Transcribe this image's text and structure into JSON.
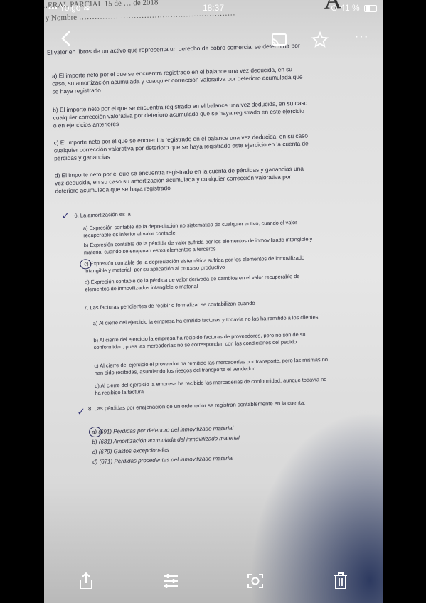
{
  "status": {
    "carrier": "Yoigo",
    "time": "18:37",
    "battery": "41 %"
  },
  "document": {
    "header_line1": "…ERAL PARCIAL 15 de … de 2018",
    "header_line2": "s y Nombre ……………………………………………………",
    "question5": {
      "text": "El valor en libros de un activo que representa un derecho de cobro comercial se determina por",
      "options": [
        {
          "letter": "a)",
          "text": "El importe neto por el que se encuentra registrado en el balance una vez deducida, en su caso, su amortización acumulada y cualquier corrección valorativa por deterioro acumulada que se haya registrado"
        },
        {
          "letter": "b)",
          "text": "El importe neto por el que se encuentra registrado en el balance una vez deducida, en su caso cualquier corrección valorativa por deterioro acumulada que se haya registrado en este ejercicio o en ejercicios anteriores"
        },
        {
          "letter": "c)",
          "text": "El importe neto por el que se encuentra registrado en el balance una vez deducida, en su caso cualquier corrección valorativa por deterioro que se haya registrado este ejercicio en la cuenta de pérdidas y ganancias"
        },
        {
          "letter": "d)",
          "text": "El importe neto por el que se encuentra registrado en la cuenta de pérdidas y ganancias una vez deducida, en su caso su amortización acumulada y cualquier corrección valorativa por deterioro acumulada que se haya registrado"
        }
      ]
    },
    "question6": {
      "number": "6.",
      "text": "La amortización es la",
      "options": [
        {
          "letter": "a)",
          "text": "Expresión contable de la depreciación no sistemática de cualquier activo, cuando el valor recuperable es inferior al valor contable"
        },
        {
          "letter": "b)",
          "text": "Expresión contable de la pérdida de valor sufrida por los elementos de inmovilizado intangible y material cuando se enajenan estos elementos a terceros"
        },
        {
          "letter": "c)",
          "text": "Expresión contable de la depreciación sistemática sufrida por los elementos de inmovilizado intangible y material, por su aplicación al proceso productivo"
        },
        {
          "letter": "d)",
          "text": "Expresión contable de la pérdida de valor derivada de cambios en el valor recuperable de elementos de inmovilizados intangible o material"
        }
      ]
    },
    "question7": {
      "number": "7.",
      "text": "Las facturas pendientes de recibir o formalizar se contabilizan cuando",
      "options": [
        {
          "letter": "a)",
          "text": "Al cierre del ejercicio la empresa ha emitido facturas y todavía no las ha remitido a los clientes"
        },
        {
          "letter": "b)",
          "text": "Al cierre del ejercicio la empresa ha recibido facturas de proveedores, pero no son de su conformidad, pues las mercaderías no se corresponden con las condiciones del pedido"
        },
        {
          "letter": "c)",
          "text": "Al cierre del ejercicio el proveedor ha remitido las mercaderías por transporte, pero las mismas no han sido recibidas, asumiendo los riesgos del transporte el vendedor"
        },
        {
          "letter": "d)",
          "text": "Al cierre del ejercicio la empresa ha recibido las mercaderías de conformidad, aunque todavía no ha recibido la factura"
        }
      ]
    },
    "question8": {
      "number": "8.",
      "text": "Las pérdidas por enajenación de un ordenador se registran contablemente en la cuenta:",
      "options": [
        {
          "letter": "a)",
          "text": "(691) Pérdidas por deterioro del inmovilizado material"
        },
        {
          "letter": "b)",
          "text": "(681) Amortización acumulada del inmovilizado material"
        },
        {
          "letter": "c)",
          "text": "(679) Gastos excepcionales"
        },
        {
          "letter": "d)",
          "text": "(671) Pérdidas procedentes del inmovilizado material"
        }
      ]
    }
  },
  "toolbar": {
    "top": [
      "back-icon",
      "cast-icon",
      "star-icon",
      "more-icon"
    ],
    "bottom": [
      "share-icon",
      "adjust-icon",
      "lens-icon",
      "delete-icon"
    ]
  }
}
